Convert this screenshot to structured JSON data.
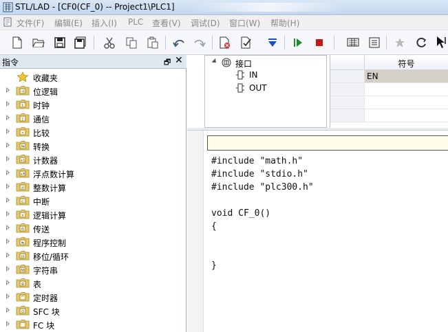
{
  "window": {
    "title": "STL/LAD - [CF0(CF_0) -- Project1\\PLC1]"
  },
  "menu": {
    "items": [
      "文件(F)",
      "编辑(E)",
      "插入(I)",
      "PLC",
      "查看(V)",
      "调试(D)",
      "窗口(W)",
      "帮助(H)"
    ]
  },
  "toolbar": {
    "icons": [
      "new-file-icon",
      "open-folder-icon",
      "save-icon",
      "save-all-icon",
      "cut-icon",
      "copy-icon",
      "paste-icon",
      "undo-icon",
      "redo-icon",
      "compile-icon",
      "check-icon",
      "download-icon",
      "run-icon",
      "stop-icon",
      "monitor-icon",
      "table-icon",
      "favorite-icon",
      "refresh-icon",
      "pointer-icon"
    ],
    "colors": {
      "run": "#1e8a2e",
      "stop": "#c81414",
      "download": "#1a4fc0"
    }
  },
  "instruction_panel": {
    "title": "指令",
    "pin_label": "🗗",
    "close_label": "✕",
    "items": [
      {
        "label": "收藏夹",
        "icon": "star-icon",
        "has_expander": false
      },
      {
        "label": "位逻辑",
        "icon": "folder-icon",
        "glyph": "⊣|",
        "has_expander": true
      },
      {
        "label": "时钟",
        "icon": "folder-icon",
        "glyph": "L",
        "has_expander": true
      },
      {
        "label": "通信",
        "icon": "folder-icon",
        "glyph": "ʃ",
        "has_expander": true
      },
      {
        "label": "比较",
        "icon": "folder-icon",
        "glyph": "<",
        "has_expander": true
      },
      {
        "label": "转换",
        "icon": "folder-icon",
        "glyph": "A▾",
        "has_expander": true
      },
      {
        "label": "计数器",
        "icon": "folder-icon",
        "glyph": "+1",
        "has_expander": true
      },
      {
        "label": "浮点数计算",
        "icon": "folder-icon",
        "glyph": "+R",
        "has_expander": true
      },
      {
        "label": "整数计算",
        "icon": "folder-icon",
        "glyph": "±I",
        "has_expander": true
      },
      {
        "label": "中断",
        "icon": "folder-icon",
        "glyph": "⊏",
        "has_expander": true
      },
      {
        "label": "逻辑计算",
        "icon": "folder-icon",
        "glyph": "∧",
        "has_expander": true
      },
      {
        "label": "传送",
        "icon": "folder-icon",
        "glyph": "A/",
        "has_expander": true
      },
      {
        "label": "程序控制",
        "icon": "folder-icon",
        "glyph": "↹",
        "has_expander": true
      },
      {
        "label": "移位/循环",
        "icon": "folder-icon",
        "glyph": "|||",
        "has_expander": true
      },
      {
        "label": "字符串",
        "icon": "folder-icon",
        "glyph": "AB",
        "has_expander": true
      },
      {
        "label": "表",
        "icon": "folder-icon",
        "glyph": "⊞",
        "has_expander": true
      },
      {
        "label": "定时器",
        "icon": "folder-icon",
        "glyph": "⌒",
        "has_expander": true
      },
      {
        "label": "SFC 块",
        "icon": "folder-icon",
        "glyph": "⊡",
        "has_expander": true
      },
      {
        "label": "FC 块",
        "icon": "folder-icon",
        "glyph": "",
        "has_expander": true
      }
    ]
  },
  "interface_tree": {
    "root": "接口",
    "children": [
      "IN",
      "OUT"
    ]
  },
  "symbol_table": {
    "header": "符号",
    "rows": [
      "EN",
      "",
      "",
      ""
    ],
    "selected_row": 0
  },
  "code_editor": {
    "lines": [
      "#include \"math.h\"",
      "#include \"stdio.h\"",
      "#include \"plc300.h\"",
      "",
      "void CF_0()",
      "{",
      "",
      "",
      "}"
    ]
  }
}
